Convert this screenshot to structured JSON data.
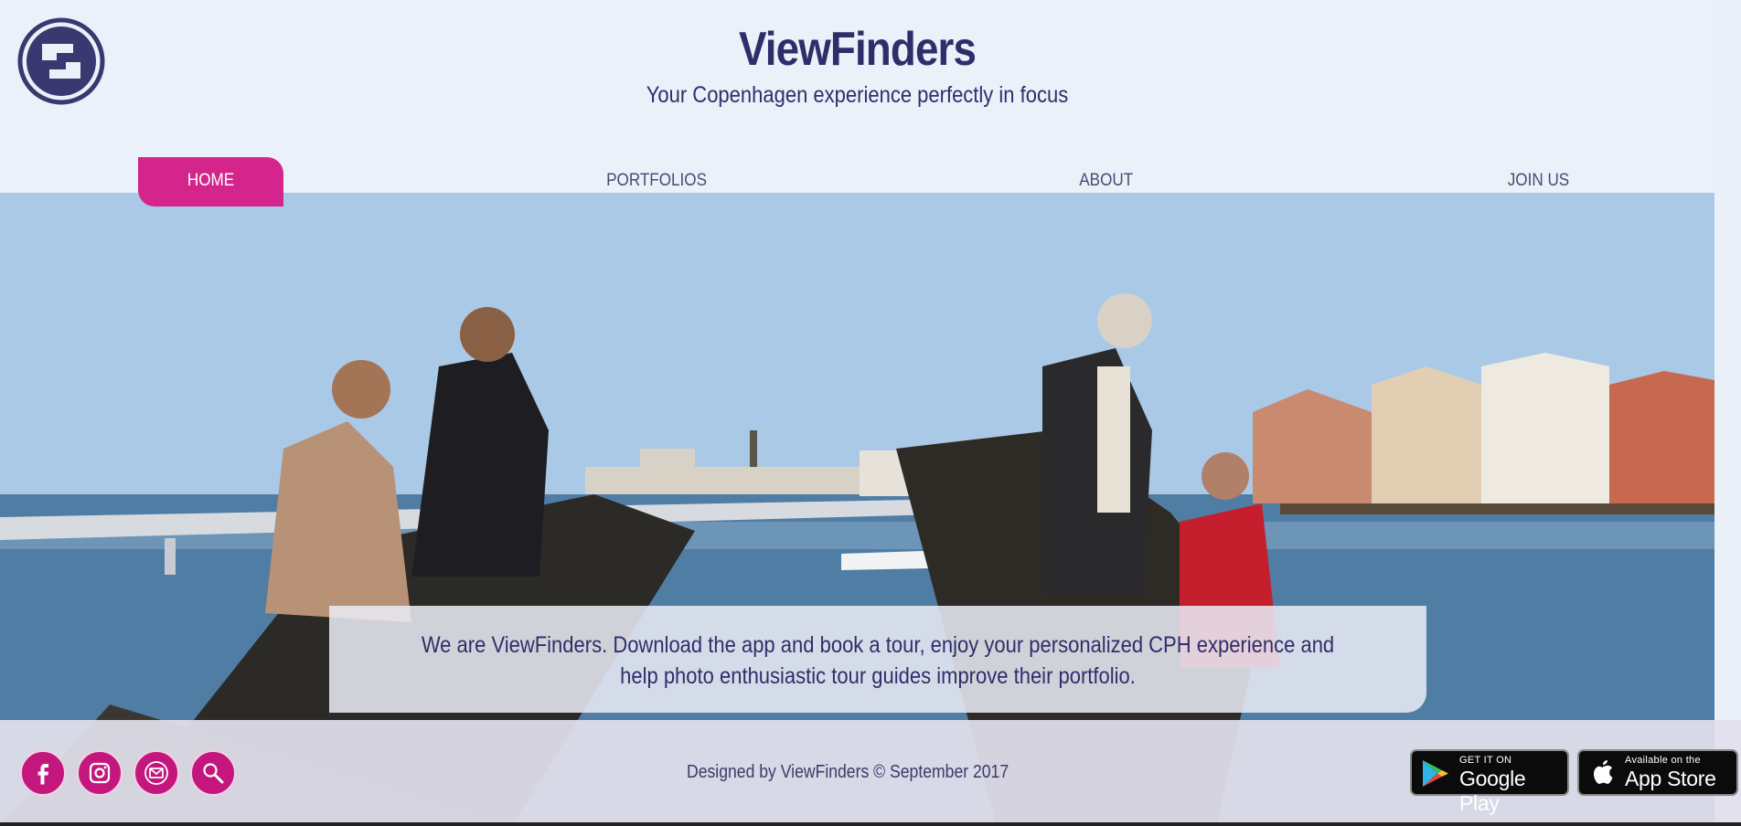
{
  "header": {
    "title": "ViewFinders",
    "tagline": "Your Copenhagen experience perfectly in focus",
    "logo_icon": "viewfinder-logo-icon"
  },
  "nav": {
    "items": [
      {
        "label": "HOME",
        "active": true
      },
      {
        "label": "PORTFOLIOS",
        "active": false
      },
      {
        "label": "ABOUT",
        "active": false
      },
      {
        "label": "JOIN US",
        "active": false
      }
    ]
  },
  "hero": {
    "image_subject": "friends sitting on a sculpture by Copenhagen harbour",
    "intro": "We are ViewFinders. Download the app and book a tour, enjoy your personalized CPH experience and help photo enthusiastic tour guides improve their portfolio."
  },
  "footer": {
    "social": [
      {
        "icon": "facebook-icon"
      },
      {
        "icon": "instagram-icon"
      },
      {
        "icon": "mail-icon"
      },
      {
        "icon": "search-icon"
      }
    ],
    "credit": "Designed by ViewFinders © September 2017",
    "stores": [
      {
        "small": "GET IT ON",
        "big": "Google Play",
        "icon": "google-play-icon"
      },
      {
        "small": "Available on the",
        "big": "App Store",
        "icon": "apple-icon"
      }
    ]
  },
  "colors": {
    "brand": "#2f2e6b",
    "accent": "#d4258c",
    "social": "#c4177e"
  }
}
